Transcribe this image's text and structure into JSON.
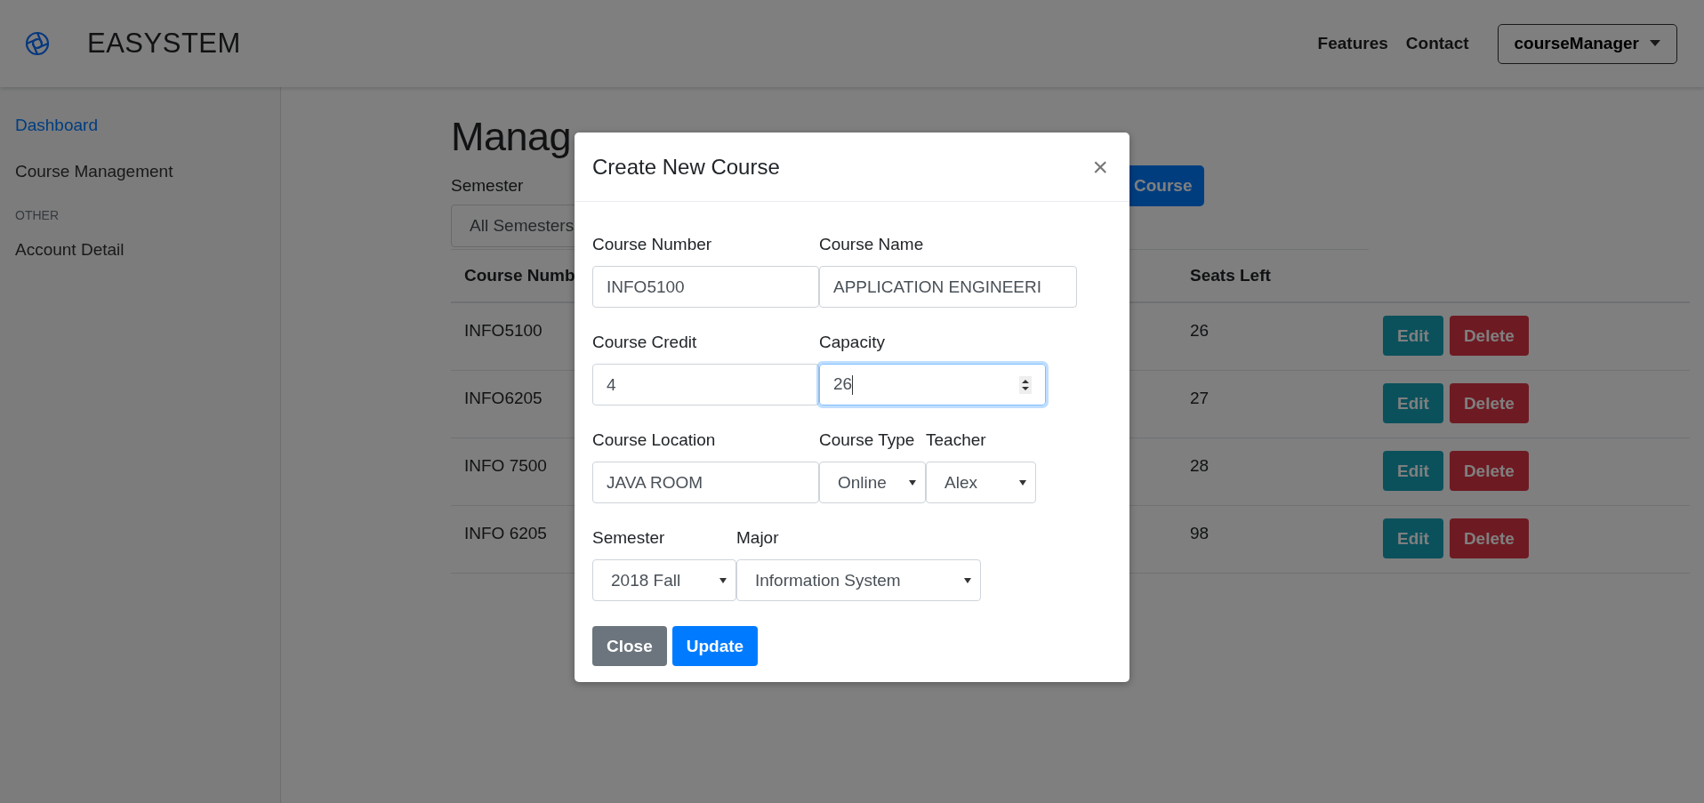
{
  "navbar": {
    "brand": "EASYSTEM",
    "links": [
      "Features",
      "Contact"
    ],
    "user_menu": "courseManager"
  },
  "sidebar": {
    "items": [
      {
        "label": "Dashboard",
        "selected": true
      },
      {
        "label": "Course Management",
        "selected": false
      }
    ],
    "section": "OTHER",
    "section_items": [
      {
        "label": "Account Detail",
        "selected": false
      }
    ]
  },
  "page": {
    "title": "Manag",
    "filter_label": "Semester",
    "filter_value": "All Semesters",
    "add_button": "Course"
  },
  "table": {
    "columns": [
      "Course Numb",
      "Seats Left"
    ],
    "rows": [
      {
        "course_number": "INFO5100",
        "seats_left": "26",
        "actions": [
          {
            "label": "Edit",
            "kind": "edit"
          },
          {
            "label": "Delete",
            "kind": "delete"
          }
        ]
      },
      {
        "course_number": "INFO6205",
        "seats_left": "27",
        "actions": [
          {
            "label": "Edit",
            "kind": "edit"
          },
          {
            "label": "Delete",
            "kind": "delete"
          }
        ]
      },
      {
        "course_number": "INFO 7500",
        "seats_left": "28",
        "actions": [
          {
            "label": "Edit",
            "kind": "edit"
          },
          {
            "label": "Delete",
            "kind": "delete"
          }
        ]
      },
      {
        "course_number": "INFO 6205",
        "seats_left": "98",
        "actions": [
          {
            "label": "Edit",
            "kind": "edit"
          },
          {
            "label": "Delete",
            "kind": "delete"
          }
        ]
      }
    ]
  },
  "modal": {
    "title": "Create New Course",
    "close": "×",
    "rows": [
      [
        {
          "label": "Course Number",
          "kind": "text",
          "value": "INFO5100",
          "focused": false
        },
        {
          "label": "Course Name",
          "kind": "text",
          "value": "APPLICATION ENGINEERI",
          "focused": false
        }
      ],
      [
        {
          "label": "Course Credit",
          "kind": "text",
          "value": "4",
          "focused": false
        },
        {
          "label": "Capacity",
          "kind": "number",
          "value": "26",
          "focused": true
        }
      ],
      [
        {
          "label": "Course Location",
          "kind": "text",
          "value": "JAVA ROOM",
          "focused": false
        },
        {
          "label": "Course Type",
          "kind": "select",
          "value": "Online",
          "focused": false
        },
        {
          "label": "Teacher",
          "kind": "select",
          "value": "Alex",
          "focused": false
        }
      ],
      [
        {
          "label": "Semester",
          "kind": "select",
          "value": "2018 Fall",
          "focused": false
        },
        {
          "label": "Major",
          "kind": "select",
          "value": "Information System",
          "focused": false
        }
      ]
    ],
    "buttons": [
      {
        "label": "Close",
        "kind": "secondary"
      },
      {
        "label": "Update",
        "kind": "primary"
      }
    ]
  }
}
